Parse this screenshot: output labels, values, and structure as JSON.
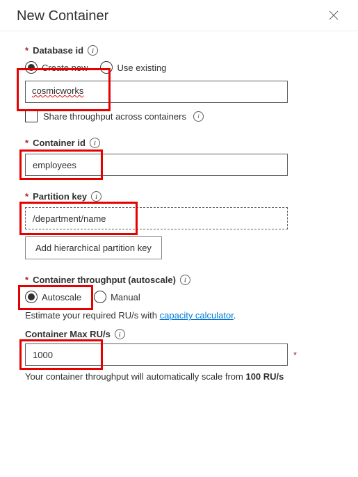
{
  "header": {
    "title": "New Container"
  },
  "databaseId": {
    "label": "Database id",
    "createNew": "Create new",
    "useExisting": "Use existing",
    "value": "cosmicworks",
    "shareThroughput": "Share throughput across containers"
  },
  "containerId": {
    "label": "Container id",
    "value": "employees"
  },
  "partitionKey": {
    "label": "Partition key",
    "value": "/department/name",
    "hierarchicalButton": "Add hierarchical partition key"
  },
  "throughput": {
    "label": "Container throughput (autoscale)",
    "autoscale": "Autoscale",
    "manual": "Manual",
    "estimatePrefix": "Estimate your required RU/s with ",
    "estimateLink": "capacity calculator",
    "maxRuLabel": "Container Max RU/s",
    "maxRuValue": "1000",
    "scalePrefix": "Your container throughput will automatically scale from ",
    "scaleBold": "100 RU/s"
  }
}
